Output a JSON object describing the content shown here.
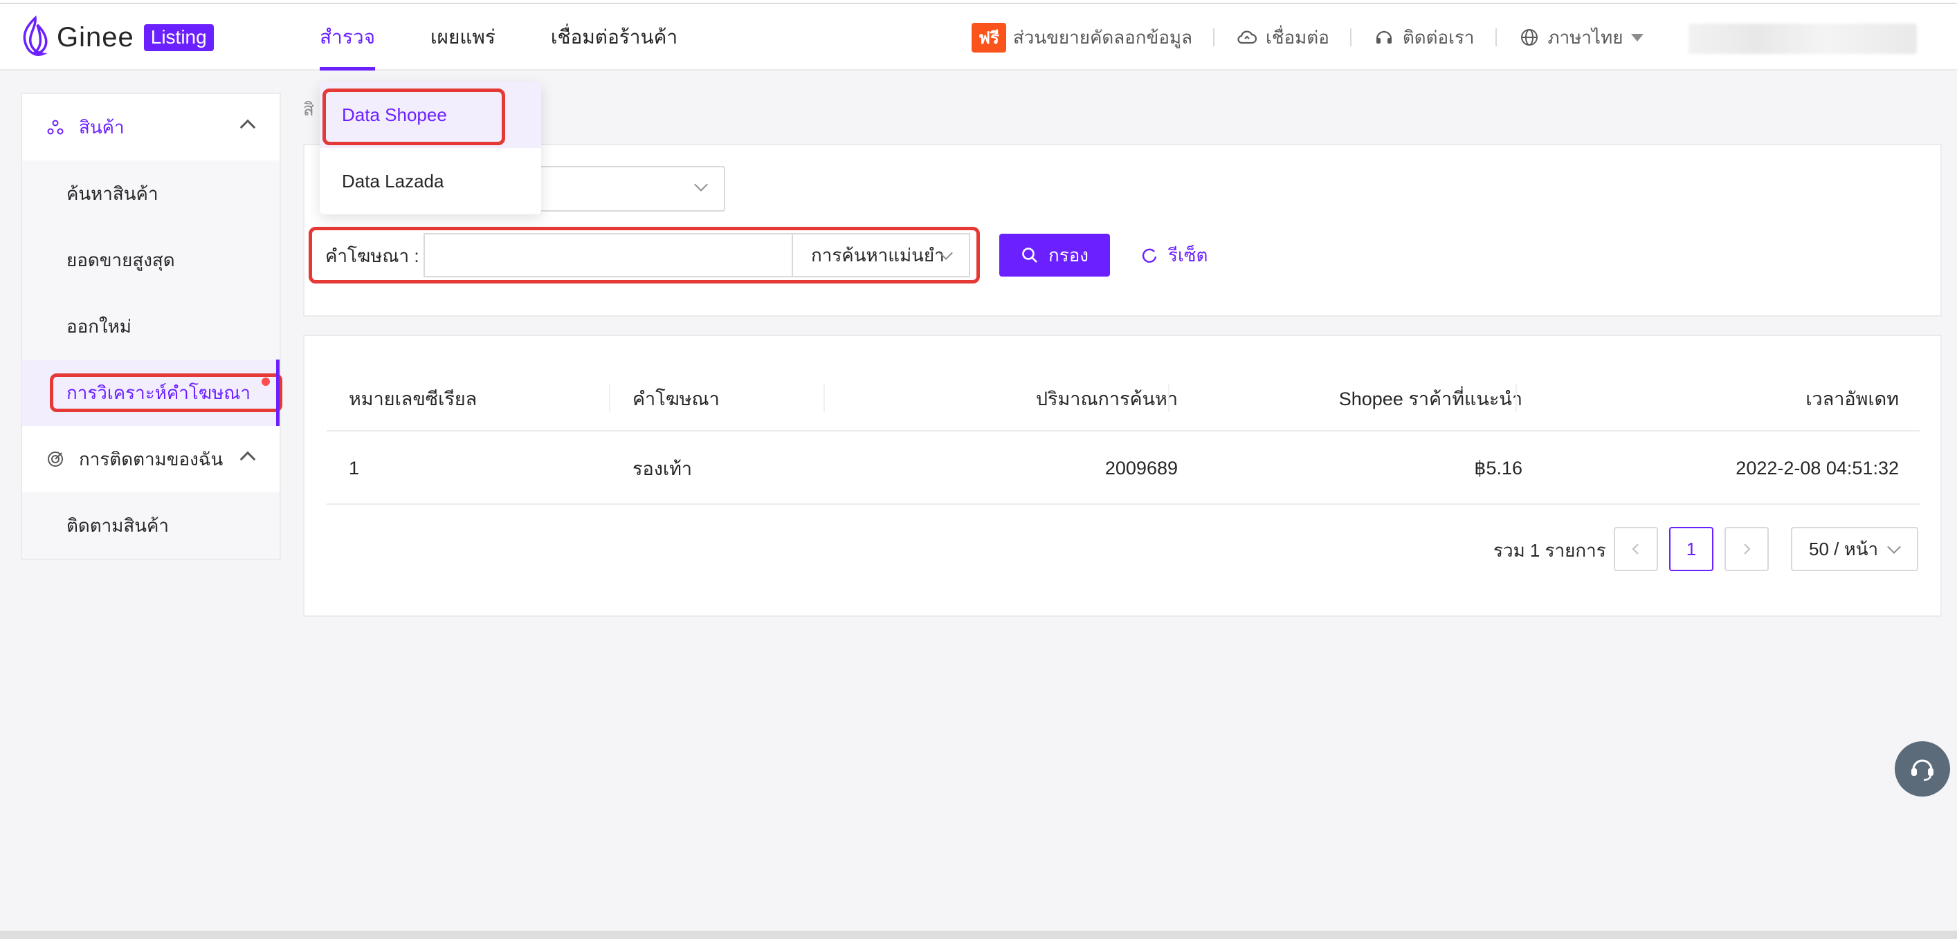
{
  "brand": {
    "name": "Ginee",
    "badge": "Listing",
    "accent": "#6b21ff"
  },
  "nav": {
    "items": [
      {
        "label": "สำรวจ",
        "active": true
      },
      {
        "label": "เผยแพร่",
        "active": false
      },
      {
        "label": "เชื่อมต่อร้านค้า",
        "active": false
      }
    ]
  },
  "header_right": {
    "free_tag": "ฟรี",
    "extension": "ส่วนขยายคัดลอกข้อมูล",
    "connect": "เชื่อมต่อ",
    "contact": "ติดต่อเรา",
    "language": "ภาษาไทย"
  },
  "dropdown": {
    "items": [
      {
        "label": "Data Shopee",
        "active": true
      },
      {
        "label": "Data Lazada",
        "active": false
      }
    ]
  },
  "sidebar": {
    "group1": {
      "label": "สินค้า",
      "icon": "cube-icon"
    },
    "items": [
      {
        "label": "ค้นหาสินค้า"
      },
      {
        "label": "ยอดขายสูงสุด"
      },
      {
        "label": "ออกใหม่"
      },
      {
        "label": "การวิเคราะห์คำโฆษณา",
        "active": true
      }
    ],
    "group2": {
      "label": "การติดตามของฉัน",
      "icon": "target-icon"
    },
    "items2": [
      {
        "label": "ติดตามสินค้า"
      }
    ]
  },
  "breadcrumb": "สิ",
  "filter": {
    "keyword_label": "คำโฆษณา :",
    "keyword_value": "",
    "match_mode": "การค้นหาแม่นยำ",
    "filter_button": "กรอง",
    "reset_button": "รีเซ็ต"
  },
  "table": {
    "columns": [
      "หมายเลขซีเรียล",
      "คำโฆษณา",
      "ปริมาณการค้นหา",
      "Shopee ราค้าที่แนะนำ",
      "เวลาอัพเดท"
    ],
    "rows": [
      [
        "1",
        "รองเท้า",
        "2009689",
        "฿5.16",
        "2022-2-08 04:51:32"
      ]
    ]
  },
  "pagination": {
    "total": "รวม 1 รายการ",
    "current_page": "1",
    "page_size": "50 / หน้า"
  }
}
